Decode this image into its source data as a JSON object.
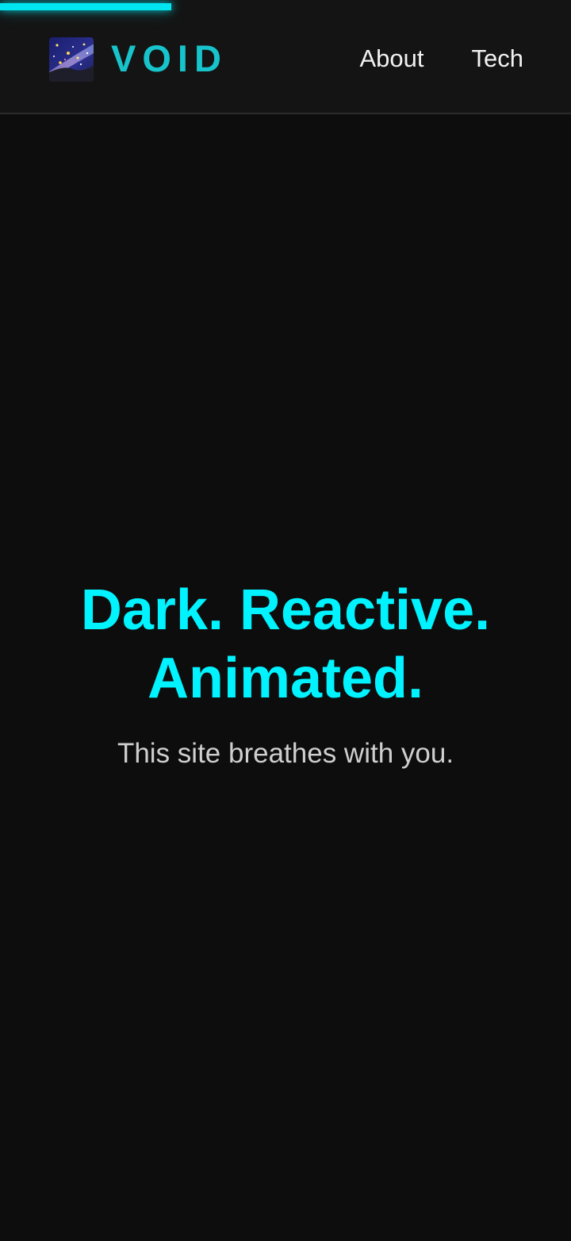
{
  "progress": {
    "percent": 30,
    "color": "#00e5f0"
  },
  "header": {
    "logo_icon": "galaxy-icon",
    "brand": "VOID",
    "brand_color": "#17c4cb",
    "nav": [
      {
        "label": "About"
      },
      {
        "label": "Tech"
      }
    ]
  },
  "hero": {
    "title_line1": "Dark. Reactive.",
    "title_line2": "Animated.",
    "subtitle": "This site breathes with you.",
    "title_color": "#00f3ff"
  }
}
